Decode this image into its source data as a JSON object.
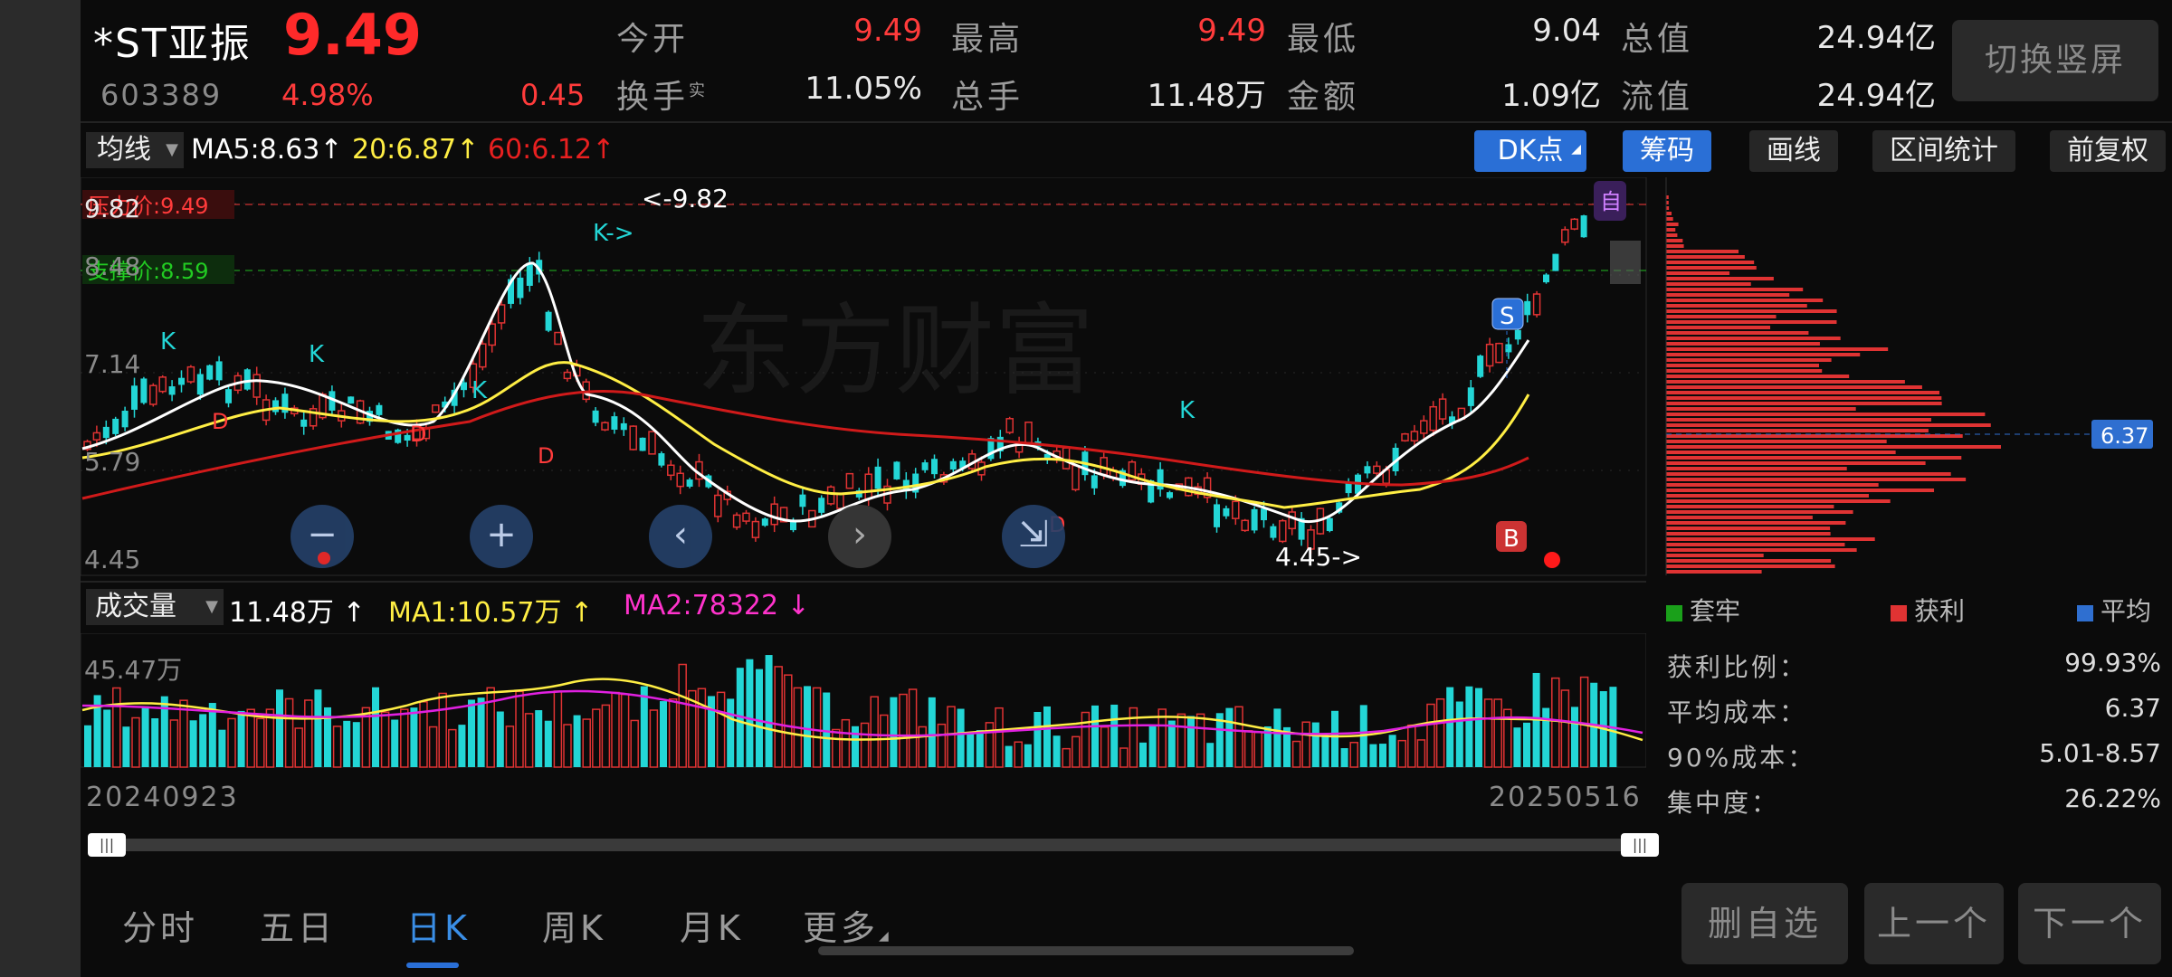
{
  "header": {
    "name": "*ST亚振",
    "price": "9.49",
    "code": "603389",
    "change_pct": "4.98%",
    "change": "0.45",
    "quotes": [
      {
        "label": "今开",
        "value": "9.49",
        "color": "#ff3b3b"
      },
      {
        "label": "最高",
        "value": "9.49",
        "color": "#ff3b3b"
      },
      {
        "label": "最低",
        "value": "9.04",
        "color": "#e8e8e8"
      },
      {
        "label": "总值",
        "value": "24.94亿",
        "color": "#e8e8e8"
      },
      {
        "label": "换手",
        "label_sup": "实",
        "value": "11.05%",
        "color": "#e8e8e8"
      },
      {
        "label": "总手",
        "value": "11.48万",
        "color": "#e8e8e8"
      },
      {
        "label": "金额",
        "value": "1.09亿",
        "color": "#e8e8e8"
      },
      {
        "label": "流值",
        "value": "24.94亿",
        "color": "#e8e8e8"
      }
    ],
    "switch_button": "切换竖屏"
  },
  "ma_bar": {
    "selector": "均线",
    "ma5": "MA5:8.63",
    "ma20": "20:6.87",
    "ma60": "60:6.12",
    "arrow_up": "↑",
    "arrow_down": "↓"
  },
  "toolbar": {
    "dk": "DK点",
    "chips": "筹码",
    "draw": "画线",
    "range_stats": "区间统计",
    "adjust": "前复权"
  },
  "price_chart": {
    "axis_labels": [
      "9.82",
      "8.48",
      "7.14",
      "5.79",
      "4.45"
    ],
    "pressure_label": "压力价:9.49",
    "support_label": "支撑价:8.59",
    "high_marker": "<-9.82",
    "low_marker": "4.45->",
    "k_marker": "K",
    "d_marker": "D",
    "s_badge": "S",
    "b_badge": "B",
    "self_badge": "自",
    "arrow_marker": "K->"
  },
  "chip_panel": {
    "avg_price_tag": "6.37",
    "legend": [
      "套牢",
      "获利",
      "平均"
    ],
    "legend_colors": [
      "#1aa01a",
      "#e03333",
      "#2f6fd0"
    ],
    "stats": [
      {
        "label": "获利比例：",
        "value": "99.93%"
      },
      {
        "label": "平均成本：",
        "value": "6.37"
      },
      {
        "label": "90%成本：",
        "value": "5.01-8.57"
      },
      {
        "label": "集中度：",
        "value": "26.22%"
      }
    ]
  },
  "volume": {
    "selector": "成交量",
    "value": "11.48万",
    "ma1": "MA1:10.57万",
    "ma2": "MA2:78322",
    "axis_top": "45.47万"
  },
  "dates": {
    "start": "20240923",
    "end": "20250516"
  },
  "slider_grip": "|||",
  "nav_buttons": [
    "−",
    "+",
    "‹",
    "›",
    "⇲"
  ],
  "tabs": [
    "分时",
    "五日",
    "日K",
    "周K",
    "月K",
    "更多"
  ],
  "active_tab": "日K",
  "bottom_buttons": [
    "删自选",
    "上一个",
    "下一个"
  ],
  "watermark": "东方财富",
  "colors": {
    "up": "#e03333",
    "down": "#23d6d6",
    "ma5": "#ffffff",
    "ma20": "#ffee44",
    "ma60": "#d01a1a"
  }
}
